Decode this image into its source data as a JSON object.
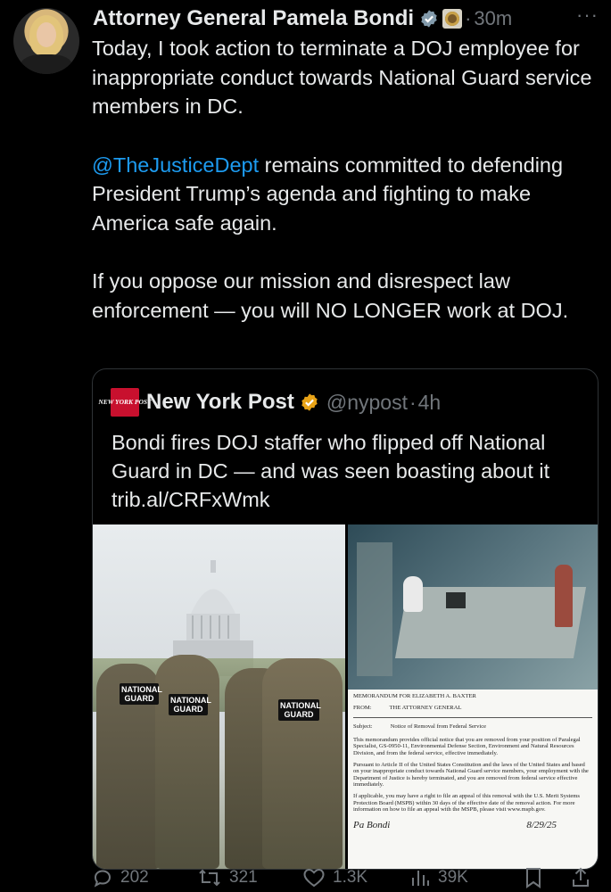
{
  "tweet": {
    "author_name": "Attorney General Pamela Bondi",
    "dot": "·",
    "time": "30m",
    "more": "···",
    "text_p1": "Today, I took action to terminate a DOJ employee for inappropriate conduct towards National Guard service members in DC.",
    "mention": "@TheJusticeDept",
    "text_p2_rest": " remains committed to defending President Trump’s agenda and fighting to make America safe again.",
    "text_p3": "If you oppose our mission and disrespect law enforcement — you will NO LONGER work at DOJ."
  },
  "quote": {
    "logo_text": "NEW YORK POST",
    "name": "New York Post",
    "handle": "@nypost",
    "dot": "·",
    "time": "4h",
    "text": "Bondi fires DOJ staffer who flipped off National Guard in DC — and was seen boasting about it trib.al/CRFxWmk",
    "patch_text": "NATIONAL GUARD",
    "memo": {
      "to": "MEMORANDUM FOR ELIZABETH A. BAXTER",
      "from_label": "FROM:",
      "from_value": "THE ATTORNEY GENERAL",
      "subject_label": "Subject:",
      "subject_value": "Notice of Removal from Federal Service",
      "para1": "This memorandum provides official notice that you are removed from your position of Paralegal Specialist, GS-0950-11, Environmental Defense Section, Environment and Natural Resources Division, and from the federal service, effective immediately.",
      "para2": "Pursuant to Article II of the United States Constitution and the laws of the United States and based on your inappropriate conduct towards National Guard service members, your employment with the Department of Justice is hereby terminated, and you are removed from federal service effective immediately.",
      "para3": "If applicable, you may have a right to file an appeal of this removal with the U.S. Merit Systems Protection Board (MSPB) within 30 days of the effective date of the removal action. For more information on how to file an appeal with the MSPB, please visit www.mspb.gov.",
      "signature": "Pa Bondi",
      "date": "8/29/25"
    }
  },
  "actions": {
    "replies": "202",
    "reposts": "321",
    "likes": "1.3K",
    "views": "39K"
  },
  "colors": {
    "background": "#000000",
    "text": "#e7e9ea",
    "muted": "#71767b",
    "link": "#1d9bf0",
    "nypost_red": "#c8102e",
    "gold_badge": "#e8a317",
    "blue_badge": "#1d9bf0"
  }
}
